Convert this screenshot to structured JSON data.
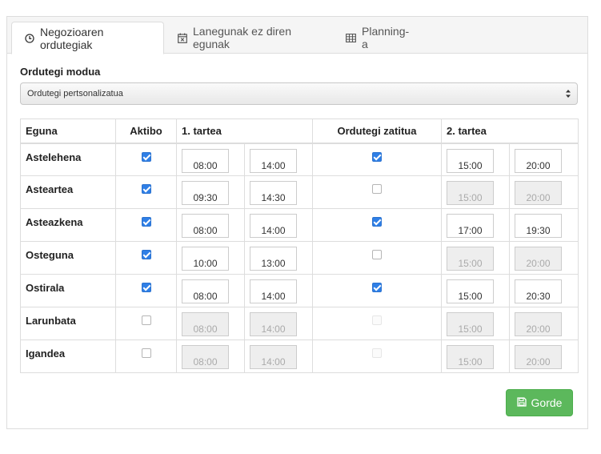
{
  "tabs": [
    {
      "label": "Negozioaren ordutegiak",
      "icon": "clock-icon",
      "active": true
    },
    {
      "label": "Lanegunak ez diren egunak",
      "icon": "calendar-x-icon",
      "active": false
    },
    {
      "label": "Planning-a",
      "icon": "table-icon",
      "active": false
    }
  ],
  "mode": {
    "label": "Ordutegi modua",
    "selected": "Ordutegi pertsonalizatua"
  },
  "table": {
    "headers": {
      "day": "Eguna",
      "active": "Aktibo",
      "range1": "1. tartea",
      "split": "Ordutegi zatitua",
      "range2": "2. tartea"
    },
    "rows": [
      {
        "day": "Astelehena",
        "active": true,
        "start1": "08:00",
        "end1": "14:00",
        "split": true,
        "start2": "15:00",
        "end2": "20:00"
      },
      {
        "day": "Asteartea",
        "active": true,
        "start1": "09:30",
        "end1": "14:30",
        "split": false,
        "start2": "15:00",
        "end2": "20:00"
      },
      {
        "day": "Asteazkena",
        "active": true,
        "start1": "08:00",
        "end1": "14:00",
        "split": true,
        "start2": "17:00",
        "end2": "19:30"
      },
      {
        "day": "Osteguna",
        "active": true,
        "start1": "10:00",
        "end1": "13:00",
        "split": false,
        "start2": "15:00",
        "end2": "20:00"
      },
      {
        "day": "Ostirala",
        "active": true,
        "start1": "08:00",
        "end1": "14:00",
        "split": true,
        "start2": "15:00",
        "end2": "20:30"
      },
      {
        "day": "Larunbata",
        "active": false,
        "start1": "08:00",
        "end1": "14:00",
        "split": false,
        "start2": "15:00",
        "end2": "20:00"
      },
      {
        "day": "Igandea",
        "active": false,
        "start1": "08:00",
        "end1": "14:00",
        "split": false,
        "start2": "15:00",
        "end2": "20:00"
      }
    ]
  },
  "save_label": "Gorde",
  "colors": {
    "accent_checkbox": "#2f7fe6",
    "save_button": "#5cb85c"
  }
}
